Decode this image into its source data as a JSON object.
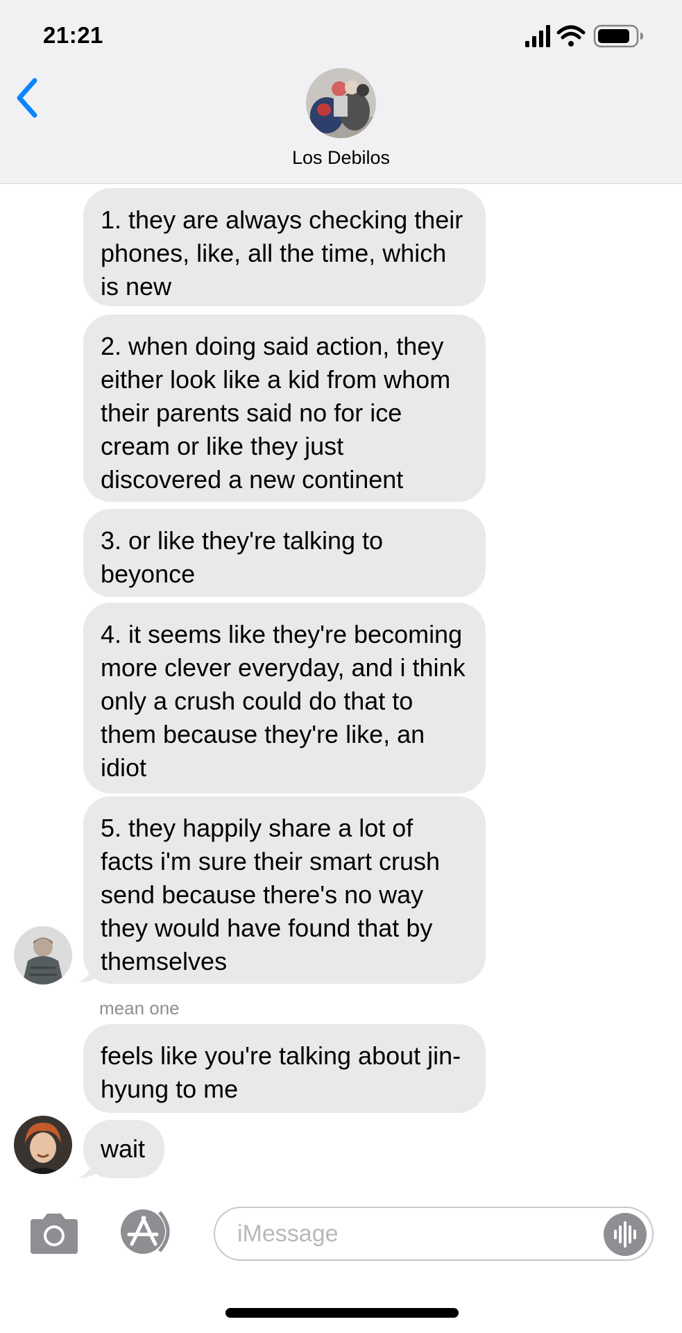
{
  "status_bar": {
    "time": "21:21"
  },
  "header": {
    "title": "Los Debilos",
    "back_icon": "chevron-left-icon",
    "avatar": "group-photo"
  },
  "messages": [
    {
      "text": "1. they are always checking their phones, like, all the time, which is new"
    },
    {
      "text": "2. when doing said action, they either look like a kid from whom their parents said no for ice cream or like they just discovered a new continent"
    },
    {
      "text": "3. or like they're talking to beyonce"
    },
    {
      "text": "4. it seems like they're becoming more clever everyday, and i think only a crush could do that to them because they're like, an idiot"
    },
    {
      "text": "5. they happily share a lot of facts i'm sure their smart crush send because there's no way they would have found that by themselves"
    },
    {
      "sender": "mean one",
      "text": "feels like you're talking about jin-hyung to me"
    },
    {
      "text": "wait"
    }
  ],
  "input_bar": {
    "placeholder": "iMessage",
    "camera_icon": "camera-icon",
    "apps_icon": "app-store-icon",
    "audio_icon": "audio-waveform-icon"
  },
  "colors": {
    "accent": "#0a84ff",
    "bubble_gray": "#e9e9eb",
    "header_bg": "#f1f1f4",
    "secondary_text": "#8e8e93"
  }
}
